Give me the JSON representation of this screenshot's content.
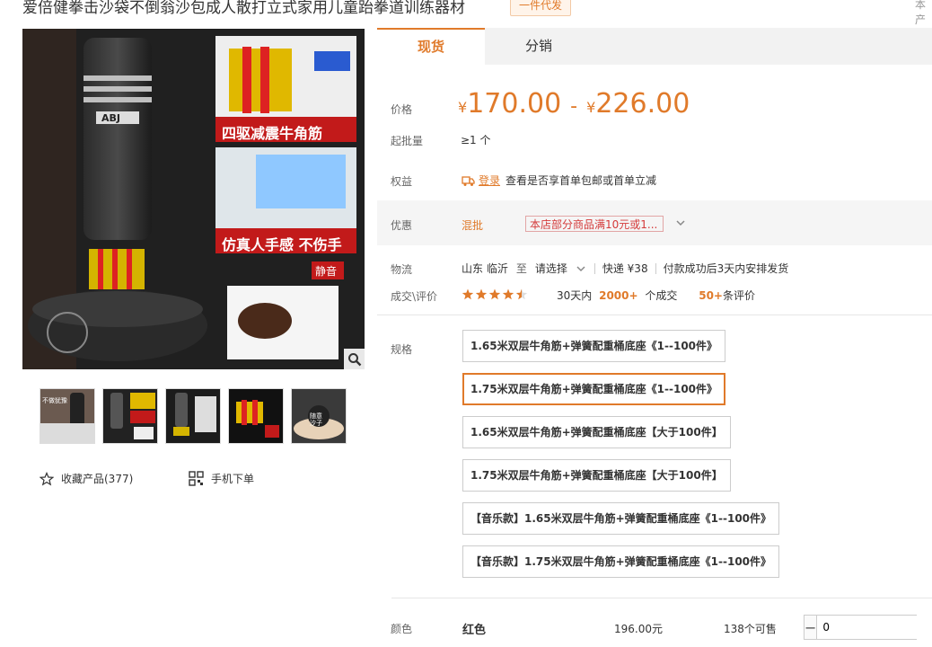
{
  "header": {
    "title": "爱倍健拳击沙袋不倒翁沙包成人散打立式家用儿童跆拳道训练器材",
    "badge": "一件代发",
    "corner": "本产"
  },
  "gallery": {
    "overlay_label_1": "四驱减震牛角筋",
    "overlay_label_2": "仿真人手感 不伤手",
    "silent_tag": "静音",
    "brand_logo": "ABJ",
    "thumbs": [
      {
        "caption": "不做犹豫"
      },
      {
        "caption": ""
      },
      {
        "caption": ""
      },
      {
        "caption": ""
      },
      {
        "caption": "随意 汐子"
      }
    ]
  },
  "actions": {
    "favorite": "收藏产品(377)",
    "mobile_order": "手机下单"
  },
  "tabs": [
    {
      "label": "现货"
    },
    {
      "label": "分销"
    }
  ],
  "price": {
    "label": "价格",
    "currency": "¥",
    "low": "170.00",
    "sep": "-",
    "high": "226.00"
  },
  "min_order": {
    "label": "起批量",
    "value": "≥1 个"
  },
  "benefit": {
    "label": "权益",
    "login": "登录",
    "text": "查看是否享首单包邮或首单立减"
  },
  "promo": {
    "label": "优惠",
    "type": "混批",
    "chip": "本店部分商品满10元或1..."
  },
  "logistics": {
    "label": "物流",
    "from": "山东 临沂",
    "to_word": "至",
    "choose": "请选择",
    "express": "快递 ¥38",
    "ship_note": "付款成功后3天内安排发货"
  },
  "deals": {
    "label": "成交\\评价",
    "rating": 4.5,
    "days": "30天内",
    "count": "2000+",
    "count_unit": "个成交",
    "reviews": "50+",
    "reviews_unit": "条评价"
  },
  "spec": {
    "label": "规格",
    "options": [
      "1.65米双层牛角筋+弹簧配重桶底座《1--100件》",
      "1.75米双层牛角筋+弹簧配重桶底座《1--100件》",
      "1.65米双层牛角筋+弹簧配重桶底座【大于100件】",
      "1.75米双层牛角筋+弹簧配重桶底座【大于100件】",
      "【音乐款】1.65米双层牛角筋+弹簧配重桶底座《1--100件》",
      "【音乐款】1.75米双层牛角筋+弹簧配重桶底座《1--100件》"
    ],
    "selected_index": 1
  },
  "color": {
    "label": "颜色",
    "name": "红色",
    "price": "196.00元",
    "stock": "138个可售",
    "qty": "0",
    "minus": "−",
    "plus": "+"
  },
  "colors": {
    "accent": "#e07a2a",
    "red": "#d43a3a"
  }
}
